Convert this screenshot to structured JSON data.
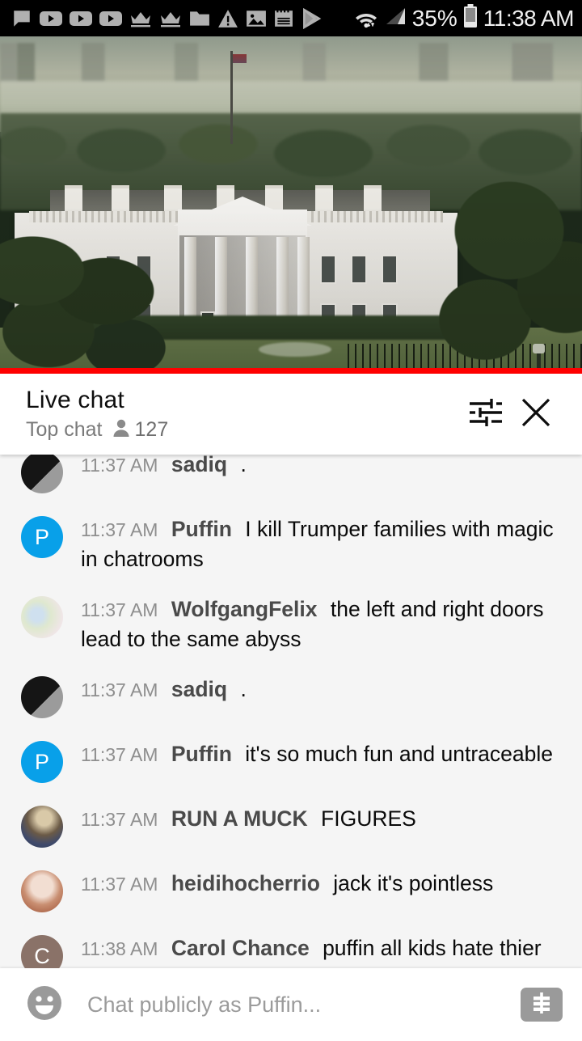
{
  "status_bar": {
    "left_icons": [
      "message-bubble-icon",
      "youtube-play-icon",
      "youtube-play-icon",
      "youtube-play-icon",
      "crown-icon",
      "crown-icon",
      "folder-icon",
      "warning-triangle-icon",
      "image-icon",
      "notepad-icon",
      "play-store-icon"
    ],
    "wifi_icon": "wifi-icon",
    "signal_icon": "cell-signal-icon",
    "battery_percent": "35%",
    "battery_icon": "battery-icon",
    "clock": "11:38 AM"
  },
  "video": {
    "description": "white-house-live-stream",
    "progress_color": "#ff0000",
    "progress_percent": 100
  },
  "chat_header": {
    "title": "Live chat",
    "mode": "Top chat",
    "viewer_icon": "person-icon",
    "viewer_count": "127",
    "settings_icon": "chat-settings-sliders-icon",
    "close_icon": "close-icon"
  },
  "messages": [
    {
      "time": "11:37 AM",
      "author": "sadiq",
      "text": ".",
      "avatar_type": "photo",
      "avatar_color": "#1a1a1a",
      "avatar_letter": ""
    },
    {
      "time": "11:37 AM",
      "author": "Puffin",
      "text": "I kill Trumper families with magic in chatrooms",
      "avatar_type": "letter",
      "avatar_color": "#08a0e9",
      "avatar_letter": "P"
    },
    {
      "time": "11:37 AM",
      "author": "WolfgangFelix",
      "text": "the left and right doors lead to the same abyss",
      "avatar_type": "photo",
      "avatar_color": "#e3ecd8",
      "avatar_letter": ""
    },
    {
      "time": "11:37 AM",
      "author": "sadiq",
      "text": ".",
      "avatar_type": "photo",
      "avatar_color": "#1a1a1a",
      "avatar_letter": ""
    },
    {
      "time": "11:37 AM",
      "author": "Puffin",
      "text": "it's so much fun and untraceable",
      "avatar_type": "letter",
      "avatar_color": "#08a0e9",
      "avatar_letter": "P"
    },
    {
      "time": "11:37 AM",
      "author": "RUN A MUCK",
      "text": "FIGURES",
      "avatar_type": "photo",
      "avatar_color": "#6e5c4a",
      "avatar_letter": ""
    },
    {
      "time": "11:37 AM",
      "author": "heidihocherrio",
      "text": "jack it's pointless",
      "avatar_type": "photo",
      "avatar_color": "#c98f72",
      "avatar_letter": ""
    },
    {
      "time": "11:38 AM",
      "author": "Carol Chance",
      "text": "puffin all kids hate thier parents at some time even great fantastic good kids",
      "avatar_type": "letter",
      "avatar_color": "#8a7268",
      "avatar_letter": "C"
    }
  ],
  "input_bar": {
    "emoji_icon": "emoji-smiley-icon",
    "placeholder": "Chat publicly as Puffin...",
    "superchat_icon": "dollar-superchat-icon"
  }
}
